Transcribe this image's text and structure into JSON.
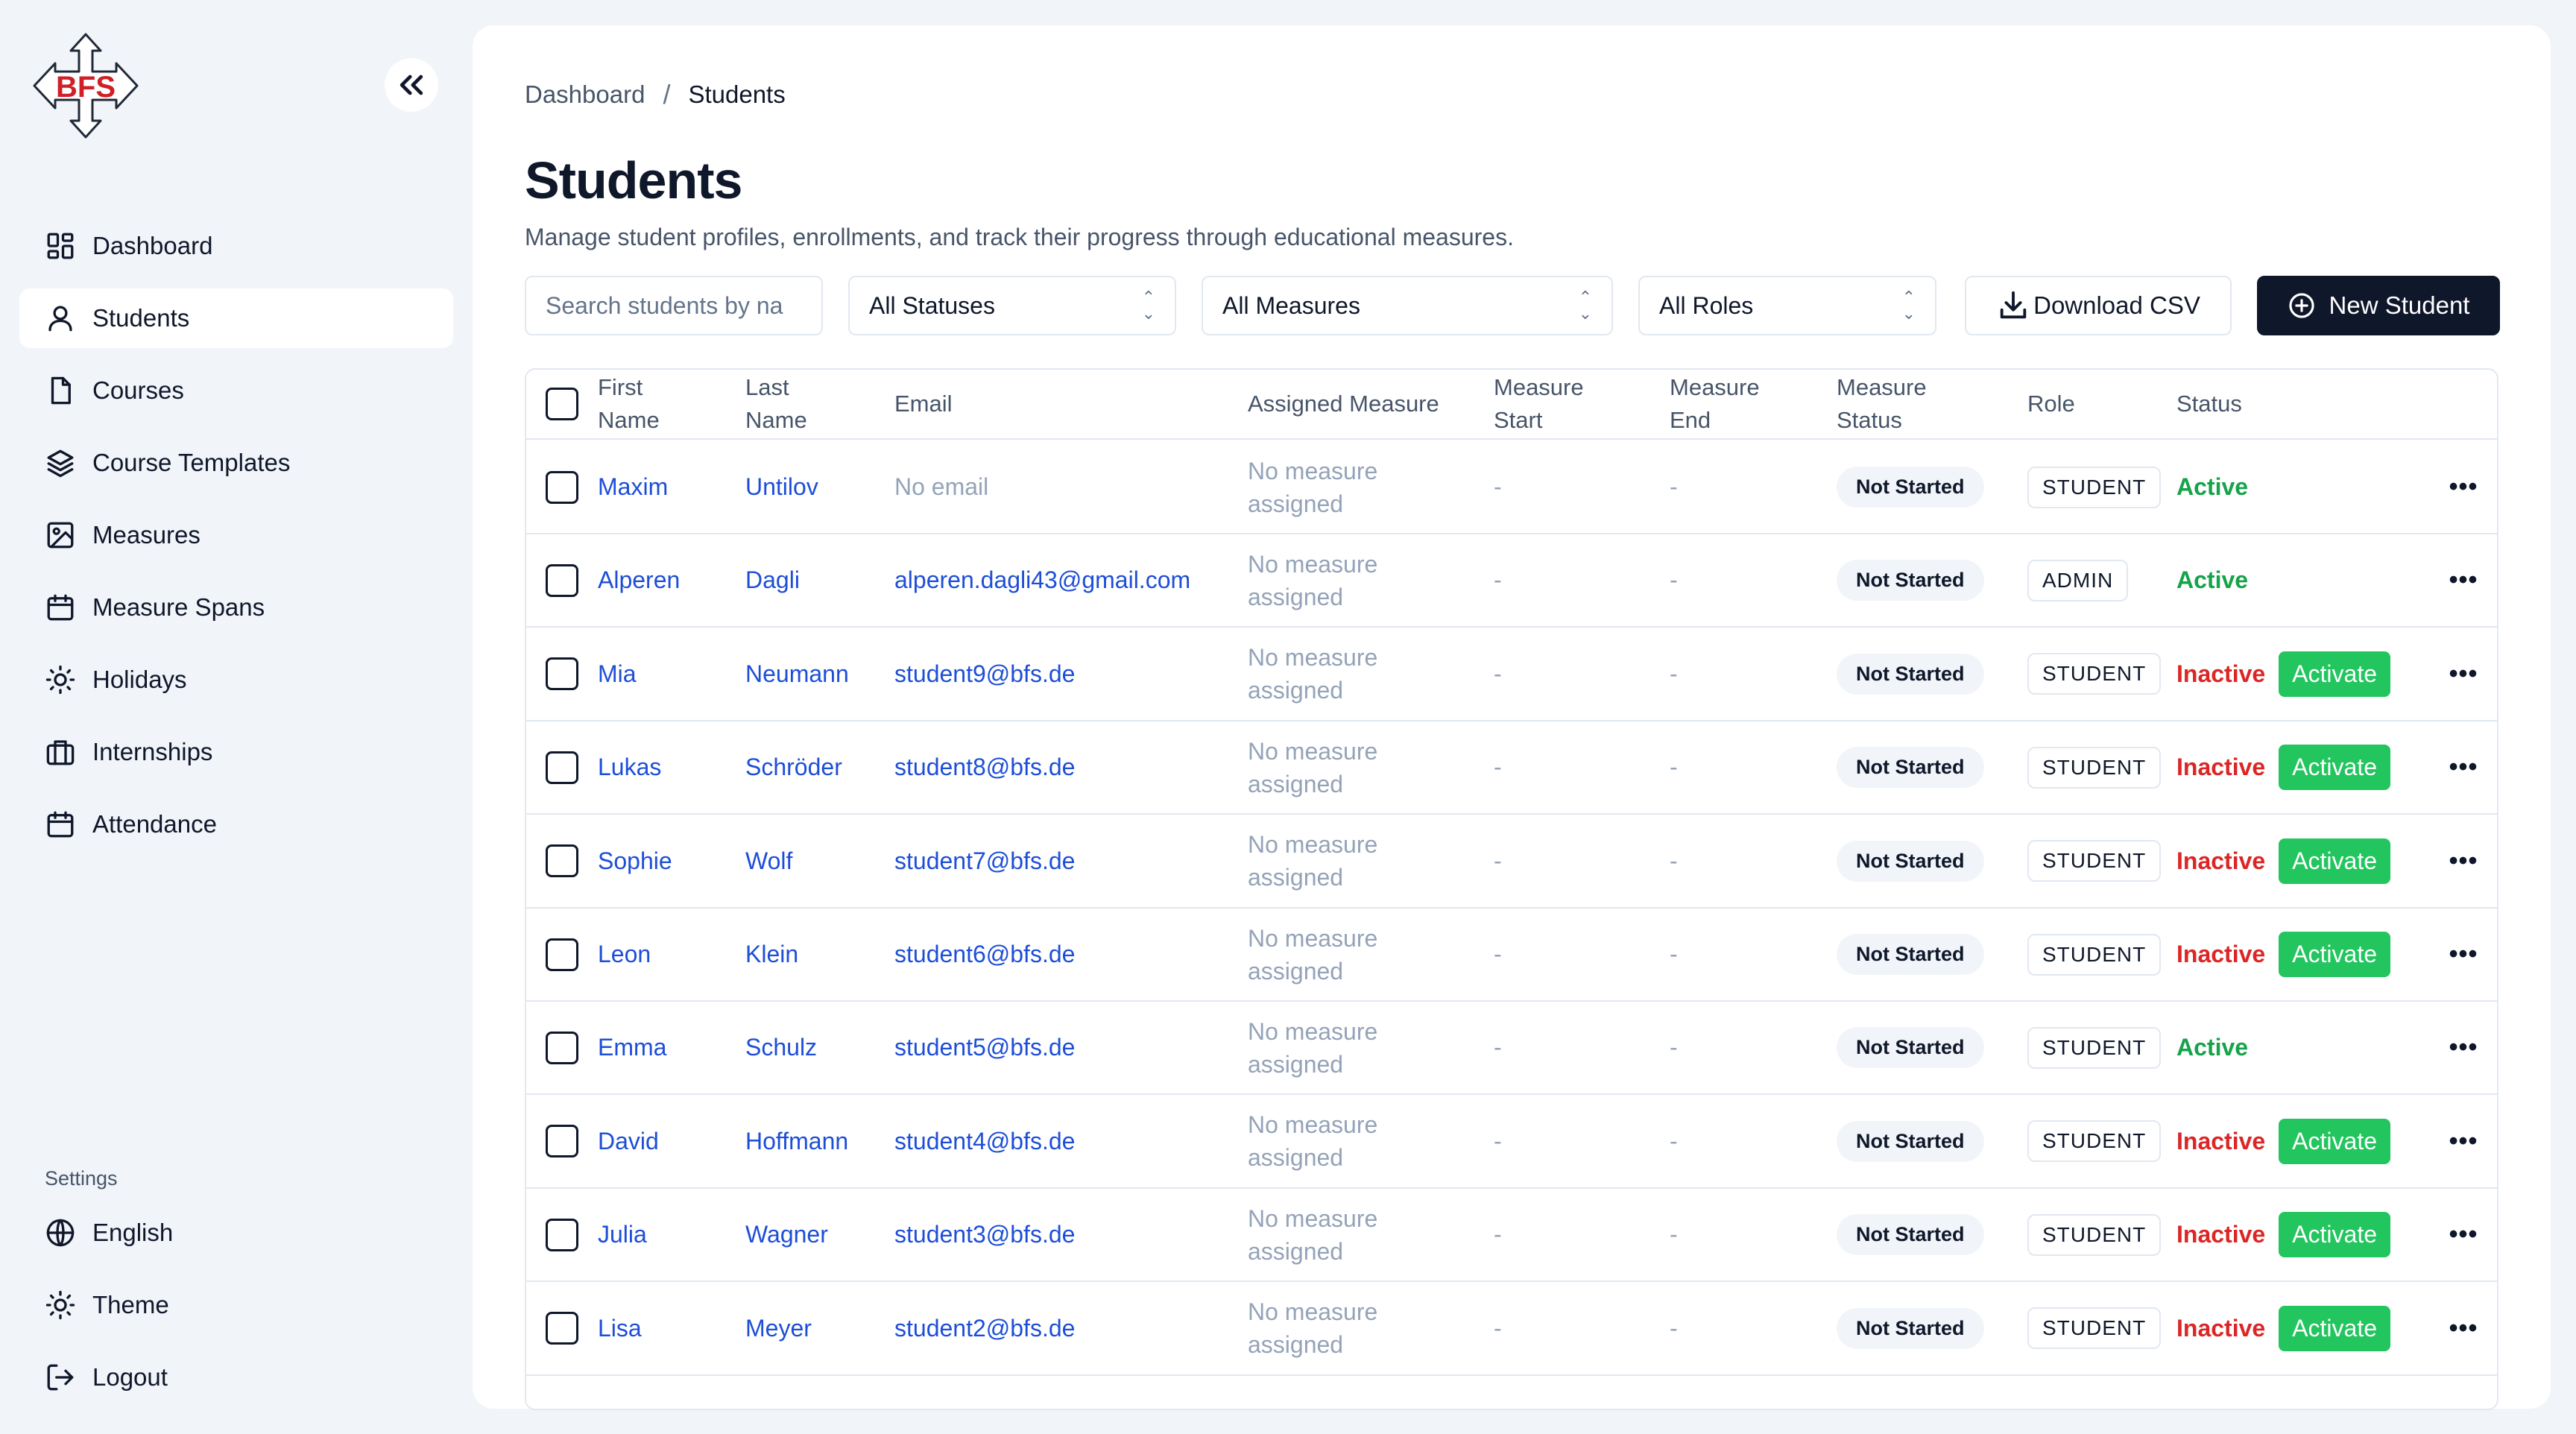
{
  "brand": {
    "logo_text": "BFS"
  },
  "sidebar": {
    "items": [
      {
        "label": "Dashboard",
        "icon": "dashboard-icon",
        "active": false
      },
      {
        "label": "Students",
        "icon": "students-icon",
        "active": true
      },
      {
        "label": "Courses",
        "icon": "courses-icon",
        "active": false
      },
      {
        "label": "Course Templates",
        "icon": "layers-icon",
        "active": false
      },
      {
        "label": "Measures",
        "icon": "image-icon",
        "active": false
      },
      {
        "label": "Measure Spans",
        "icon": "calendar-icon",
        "active": false
      },
      {
        "label": "Holidays",
        "icon": "sun-icon",
        "active": false
      },
      {
        "label": "Internships",
        "icon": "briefcase-icon",
        "active": false
      },
      {
        "label": "Attendance",
        "icon": "calendar-icon",
        "active": false
      }
    ],
    "settings_label": "Settings",
    "settings_items": [
      {
        "label": "English",
        "icon": "globe-icon"
      },
      {
        "label": "Theme",
        "icon": "sun-icon"
      },
      {
        "label": "Logout",
        "icon": "logout-icon"
      }
    ],
    "collapse_icon": "double-chevron-left-icon"
  },
  "breadcrumb": {
    "parent": "Dashboard",
    "separator": "/",
    "current": "Students"
  },
  "page": {
    "title": "Students",
    "subtitle": "Manage student profiles, enrollments, and track their progress through educational measures."
  },
  "toolbar": {
    "search_placeholder": "Search students by na",
    "status_filter": "All Statuses",
    "measure_filter": "All Measures",
    "role_filter": "All Roles",
    "download_label": "Download CSV",
    "new_label": "New Student"
  },
  "table": {
    "headers": {
      "first": "First\nName",
      "last": "Last\nName",
      "email": "Email",
      "measure": "Assigned Measure",
      "mstart": "Measure\nStart",
      "mend": "Measure\nEnd",
      "mstatus": "Measure\nStatus",
      "role": "Role",
      "status": "Status"
    },
    "rows": [
      {
        "first": "Maxim",
        "last": "Untilov",
        "email": "No email",
        "has_email": false,
        "measure": "No measure\nassigned",
        "mstart": "-",
        "mend": "-",
        "mstatus": "Not Started",
        "role": "STUDENT",
        "status": "Active",
        "active": true,
        "action": ""
      },
      {
        "first": "Alperen",
        "last": "Dagli",
        "email": "alperen.dagli43@gmail.com",
        "has_email": true,
        "measure": "No measure\nassigned",
        "mstart": "-",
        "mend": "-",
        "mstatus": "Not Started",
        "role": "ADMIN",
        "status": "Active",
        "active": true,
        "action": ""
      },
      {
        "first": "Mia",
        "last": "Neumann",
        "email": "student9@bfs.de",
        "has_email": true,
        "measure": "No measure\nassigned",
        "mstart": "-",
        "mend": "-",
        "mstatus": "Not Started",
        "role": "STUDENT",
        "status": "Inactive",
        "active": false,
        "action": "Activate"
      },
      {
        "first": "Lukas",
        "last": "Schröder",
        "email": "student8@bfs.de",
        "has_email": true,
        "measure": "No measure\nassigned",
        "mstart": "-",
        "mend": "-",
        "mstatus": "Not Started",
        "role": "STUDENT",
        "status": "Inactive",
        "active": false,
        "action": "Activate"
      },
      {
        "first": "Sophie",
        "last": "Wolf",
        "email": "student7@bfs.de",
        "has_email": true,
        "measure": "No measure\nassigned",
        "mstart": "-",
        "mend": "-",
        "mstatus": "Not Started",
        "role": "STUDENT",
        "status": "Inactive",
        "active": false,
        "action": "Activate"
      },
      {
        "first": "Leon",
        "last": "Klein",
        "email": "student6@bfs.de",
        "has_email": true,
        "measure": "No measure\nassigned",
        "mstart": "-",
        "mend": "-",
        "mstatus": "Not Started",
        "role": "STUDENT",
        "status": "Inactive",
        "active": false,
        "action": "Activate"
      },
      {
        "first": "Emma",
        "last": "Schulz",
        "email": "student5@bfs.de",
        "has_email": true,
        "measure": "No measure\nassigned",
        "mstart": "-",
        "mend": "-",
        "mstatus": "Not Started",
        "role": "STUDENT",
        "status": "Active",
        "active": true,
        "action": ""
      },
      {
        "first": "David",
        "last": "Hoffmann",
        "email": "student4@bfs.de",
        "has_email": true,
        "measure": "No measure\nassigned",
        "mstart": "-",
        "mend": "-",
        "mstatus": "Not Started",
        "role": "STUDENT",
        "status": "Inactive",
        "active": false,
        "action": "Activate"
      },
      {
        "first": "Julia",
        "last": "Wagner",
        "email": "student3@bfs.de",
        "has_email": true,
        "measure": "No measure\nassigned",
        "mstart": "-",
        "mend": "-",
        "mstatus": "Not Started",
        "role": "STUDENT",
        "status": "Inactive",
        "active": false,
        "action": "Activate"
      },
      {
        "first": "Lisa",
        "last": "Meyer",
        "email": "student2@bfs.de",
        "has_email": true,
        "measure": "No measure\nassigned",
        "mstart": "-",
        "mend": "-",
        "mstatus": "Not Started",
        "role": "STUDENT",
        "status": "Inactive",
        "active": false,
        "action": "Activate"
      }
    ]
  },
  "colors": {
    "accent": "#0f172a",
    "link": "#1d4ed8",
    "active": "#16a34a",
    "inactive": "#dc2626",
    "activate_button": "#22c55e",
    "logo_red": "#d11f26"
  }
}
